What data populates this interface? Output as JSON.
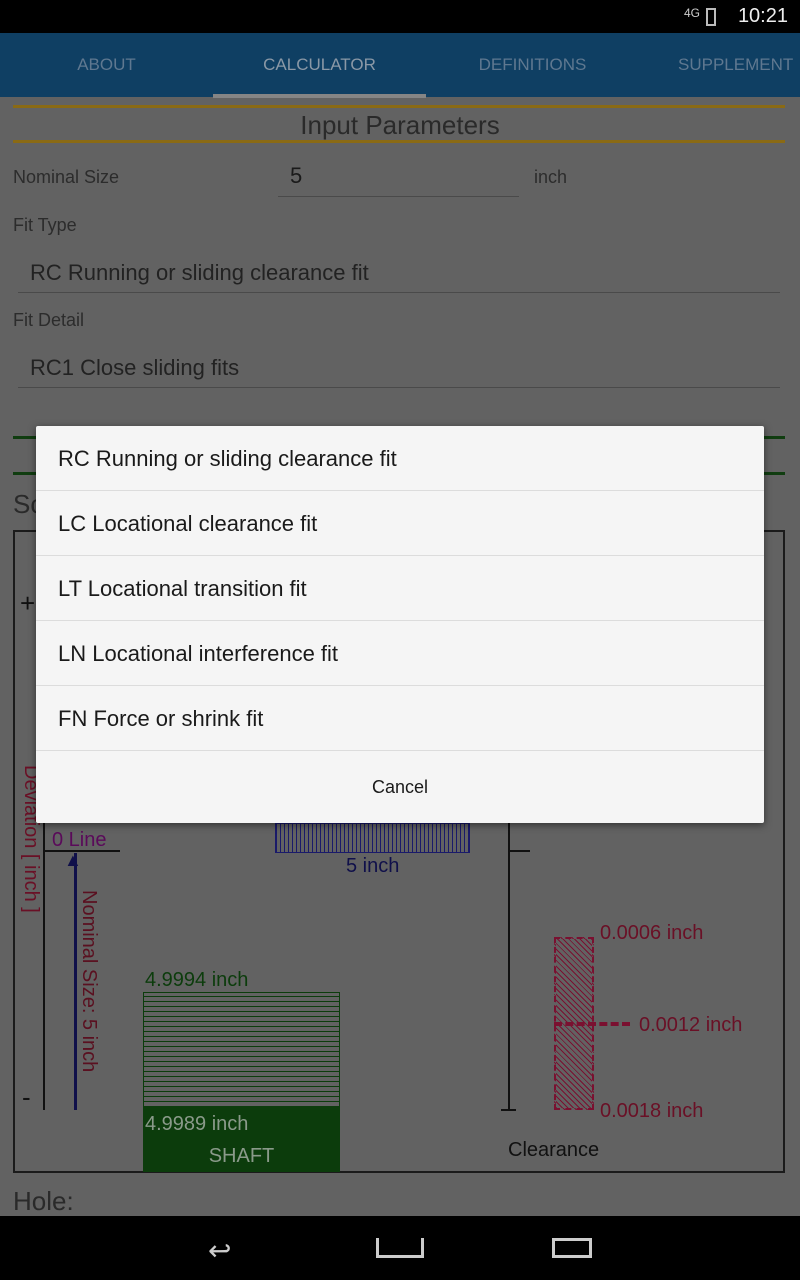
{
  "status_bar": {
    "network": "4G",
    "time": "10:21"
  },
  "tabs": [
    {
      "label": "ABOUT"
    },
    {
      "label": "CALCULATOR",
      "active": true
    },
    {
      "label": "DEFINITIONS"
    },
    {
      "label": "SUPPLEMENT"
    }
  ],
  "form": {
    "section_title": "Input Parameters",
    "nominal_size_label": "Nominal Size",
    "nominal_size_value": "5",
    "nominal_size_unit": "inch",
    "fit_type_label": "Fit Type",
    "fit_type_value": "RC Running or sliding clearance fit",
    "fit_detail_label": "Fit Detail",
    "fit_detail_value": "RC1 Close sliding fits",
    "schematic_partial": "Sc"
  },
  "diagram": {
    "plus": "+",
    "minus": "-",
    "deviation_label": "Deviation [ inch ]",
    "zero_line": "0 Line",
    "nominal_label": "Nominal Size: 5 inch",
    "hole_label": "5 inch",
    "shaft_upper": "4.9994 inch",
    "shaft_lower": "4.9989 inch",
    "shaft_name": "SHAFT",
    "clearance_min": "0.0006 inch",
    "clearance_mid": "0.0012 inch",
    "clearance_max": "0.0018 inch",
    "clearance_name": "Clearance"
  },
  "hole_heading": "Hole:",
  "dialog": {
    "options": [
      "RC Running or sliding clearance fit",
      "LC Locational clearance fit",
      "LT Locational transition fit",
      "LN Locational interference fit",
      "FN Force or shrink fit"
    ],
    "cancel": "Cancel"
  },
  "colors": {
    "tab_bar": "#0f3f63",
    "accent_line": "#8a6a14",
    "shaft": "#0c3c0c",
    "hole": "#1a1a6a",
    "clearance": "#7a1030"
  }
}
